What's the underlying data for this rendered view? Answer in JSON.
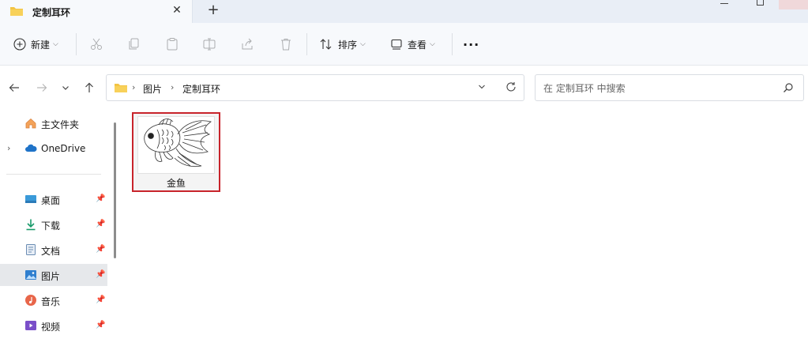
{
  "window": {
    "tab_title": "定制耳环",
    "new_tab_symbol": "+"
  },
  "toolbar": {
    "new_label": "新建",
    "sort_label": "排序",
    "view_label": "查看",
    "more_symbol": "···"
  },
  "address": {
    "crumbs": [
      "图片",
      "定制耳环"
    ]
  },
  "search": {
    "placeholder": "在 定制耳环 中搜索"
  },
  "sidebar": {
    "items": [
      {
        "label": "主文件夹",
        "icon": "home-icon",
        "pinned": false
      },
      {
        "label": "OneDrive",
        "icon": "cloud-icon",
        "pinned": false,
        "expandable": true
      },
      {
        "label": "桌面",
        "icon": "desktop-icon",
        "pinned": true
      },
      {
        "label": "下载",
        "icon": "download-icon",
        "pinned": true
      },
      {
        "label": "文档",
        "icon": "document-icon",
        "pinned": true
      },
      {
        "label": "图片",
        "icon": "pictures-icon",
        "pinned": true,
        "selected": true
      },
      {
        "label": "音乐",
        "icon": "music-icon",
        "pinned": true
      },
      {
        "label": "视频",
        "icon": "video-icon",
        "pinned": true
      }
    ]
  },
  "files": [
    {
      "name": "金鱼",
      "type": "image",
      "selected": true
    }
  ],
  "colors": {
    "selection_outline": "#c8242b",
    "folder_yellow": "#f3c443",
    "onedrive_blue": "#1f73c8"
  }
}
